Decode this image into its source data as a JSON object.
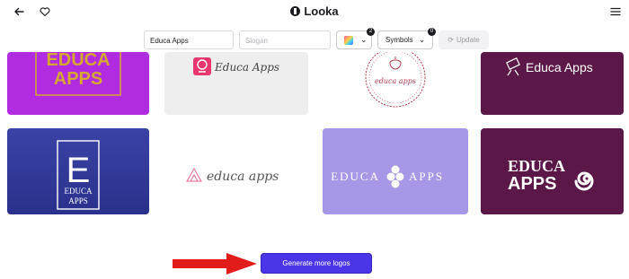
{
  "header": {
    "brand": "Looka",
    "back_icon": "arrow-left-icon",
    "favorite_icon": "heart-outline-icon",
    "menu_icon": "hamburger-menu-icon"
  },
  "toolbar": {
    "company_name_value": "Educa Apps",
    "slogan_placeholder": "Slogan",
    "colors_badge": "2",
    "symbols_label": "Symbols",
    "symbols_badge": "0",
    "update_label": "Update"
  },
  "logos": [
    {
      "id": "logo-1",
      "line1": "EDUCA",
      "line2": "APPS",
      "bg": "#b12ce0",
      "fg": "#d6a832"
    },
    {
      "id": "logo-2",
      "text": "Educa Apps",
      "bg": "#eeeeef",
      "fg": "#444444",
      "accent": "#e8386f"
    },
    {
      "id": "logo-3",
      "text": "educa apps",
      "bg": "#ffffff",
      "fg": "#b23b4e"
    },
    {
      "id": "logo-4",
      "text": "Educa Apps",
      "bg": "#5c1848",
      "fg": "#ffffff"
    },
    {
      "id": "logo-5",
      "letter": "E",
      "line1": "EDUCA",
      "line2": "APPS",
      "bg": "#2e3796",
      "fg": "#ffffff"
    },
    {
      "id": "logo-6",
      "text": "educa apps",
      "bg": "#ffffff",
      "fg": "#555555",
      "accent": "#e7668f"
    },
    {
      "id": "logo-7",
      "left": "EDUCA",
      "right": "APPS",
      "bg": "#a897e6",
      "fg": "#ffffff"
    },
    {
      "id": "logo-8",
      "line1": "EDUCA",
      "line2": "APPS",
      "bg": "#5a1748",
      "fg": "#ffffff"
    }
  ],
  "generate_button": "Generate more logos",
  "colors": {
    "accent": "#4b35e8",
    "arrow": "#e21b1b"
  }
}
